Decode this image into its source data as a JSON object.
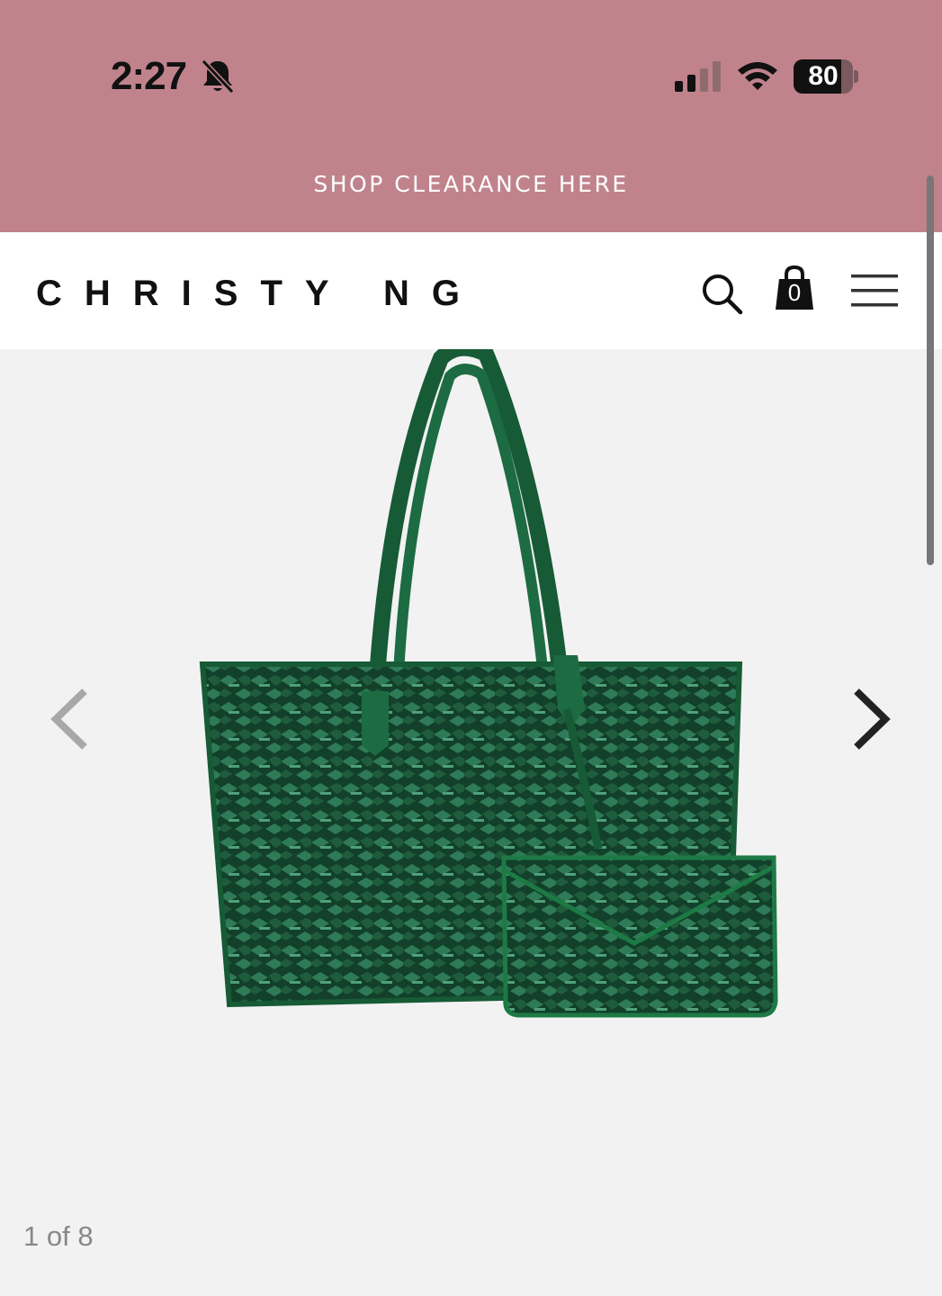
{
  "status_bar": {
    "time": "2:27",
    "battery_percent": "80",
    "battery_level": 0.8
  },
  "banner": {
    "text": "SHOP CLEARANCE HERE"
  },
  "header": {
    "logo": "CHRISTY NG",
    "cart_count": "0"
  },
  "gallery": {
    "counter": "1 of 8"
  },
  "colors": {
    "accent_band": "#c0838c",
    "bag_green": "#1f5c3c",
    "bag_dark": "#12402a"
  },
  "icons": [
    "bell-slash-icon",
    "cellular-signal-icon",
    "wifi-icon",
    "battery-icon",
    "search-icon",
    "shopping-bag-icon",
    "hamburger-menu-icon",
    "chevron-left-icon",
    "chevron-right-icon"
  ]
}
